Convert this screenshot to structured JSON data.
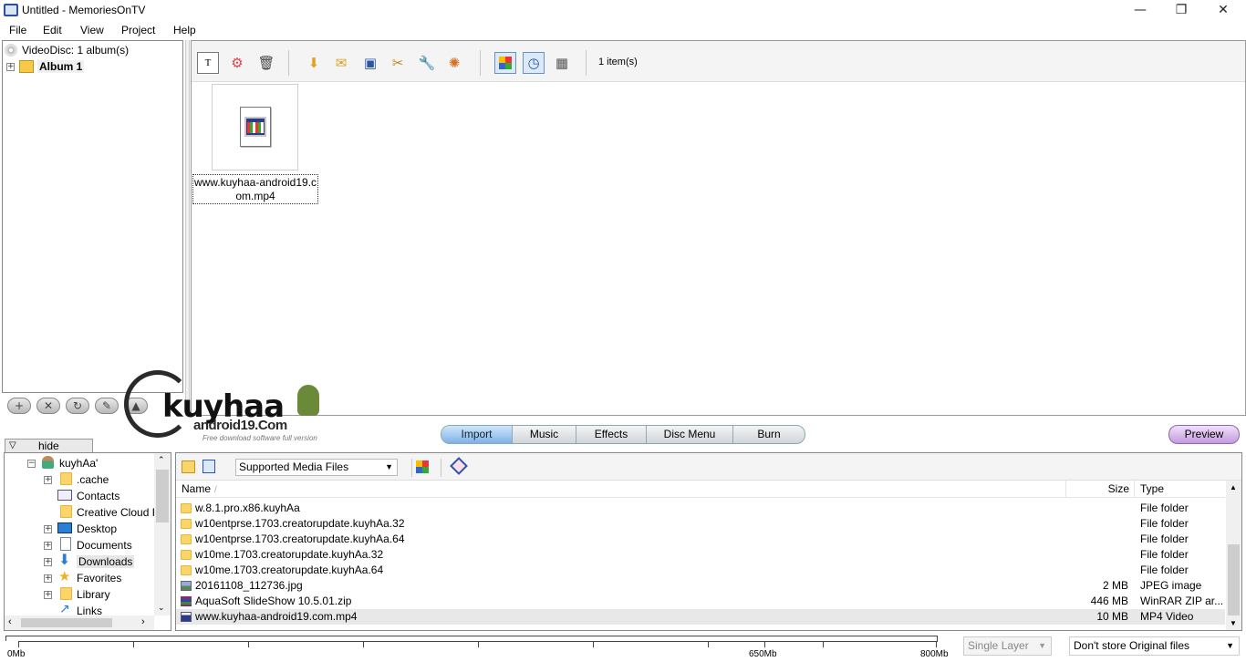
{
  "window": {
    "title": "Untitled - MemoriesOnTV",
    "minimize": "—",
    "restore": "❐",
    "close": "✕"
  },
  "menu": [
    "File",
    "Edit",
    "View",
    "Project",
    "Help"
  ],
  "disc_tree": {
    "root": "VideoDisc: 1 album(s)",
    "album": "Album 1"
  },
  "toolbar": {
    "item_count": "1 item(s)"
  },
  "media": {
    "filename": "www.kuyhaa-android19.com.mp4",
    "label_line1": "www.kuyhaa-android19.c",
    "label_line2": "om.mp4"
  },
  "watermark": {
    "brand": "kuyhaa",
    "site": "android19.Com",
    "tagline": "Free download software full version"
  },
  "tabs": [
    "Import",
    "Music",
    "Effects",
    "Disc Menu",
    "Burn"
  ],
  "active_tab": "Import",
  "preview_label": "Preview",
  "hide_label": "hide",
  "folder_tree": {
    "root": "kuyhAa'",
    "items": [
      ".cache",
      "Contacts",
      "Creative Cloud F",
      "Desktop",
      "Documents",
      "Downloads",
      "Favorites",
      "Library",
      "Links"
    ]
  },
  "file_browser": {
    "filter": "Supported Media Files",
    "columns": {
      "name": "Name",
      "size": "Size",
      "type": "Type"
    },
    "rows": [
      {
        "name": "w.8.1.pro.x86.kuyhAa",
        "size": "",
        "type": "File folder"
      },
      {
        "name": "w10entprse.1703.creatorupdate.kuyhAa.32",
        "size": "",
        "type": "File folder"
      },
      {
        "name": "w10entprse.1703.creatorupdate.kuyhAa.64",
        "size": "",
        "type": "File folder"
      },
      {
        "name": "w10me.1703.creatorupdate.kuyhAa.32",
        "size": "",
        "type": "File folder"
      },
      {
        "name": "w10me.1703.creatorupdate.kuyhAa.64",
        "size": "",
        "type": "File folder"
      },
      {
        "name": "20161108_112736.jpg",
        "size": "2 MB",
        "type": "JPEG image"
      },
      {
        "name": "AquaSoft SlideShow 10.5.01.zip",
        "size": "446 MB",
        "type": "WinRAR ZIP ar..."
      },
      {
        "name": "www.kuyhaa-android19.com.mp4",
        "size": "10 MB",
        "type": "MP4 Video"
      }
    ]
  },
  "status": {
    "ruler_start": "0Mb",
    "ruler_mid": "650Mb",
    "ruler_end": "800Mb",
    "layer": "Single Layer",
    "store_option": "Don't store Original files"
  }
}
